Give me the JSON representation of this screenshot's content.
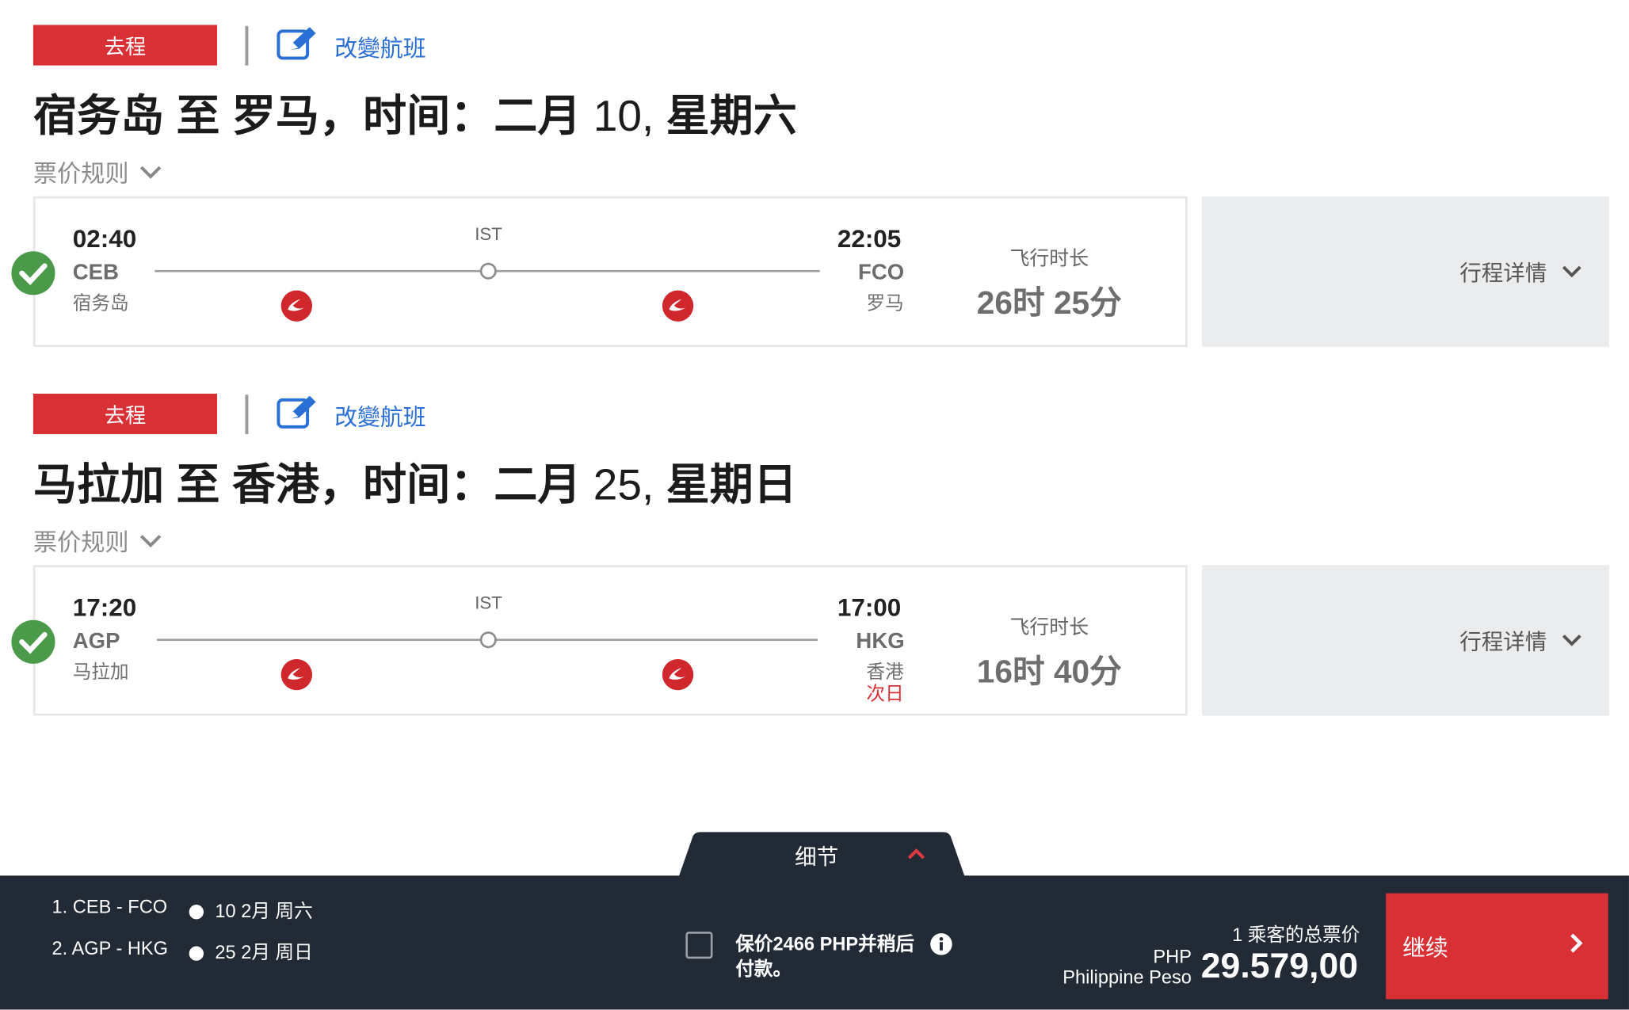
{
  "outbound": {
    "badge": "去程",
    "change_label": "改變航班",
    "title_a": "宿务岛 至 罗马，时间：二月 ",
    "title_day": "10,",
    "title_b": " 星期六",
    "fare_rules": "票价规则",
    "dep_time": "02:40",
    "dep_code": "CEB",
    "dep_city": "宿务岛",
    "via": "IST",
    "arr_time": "22:05",
    "arr_code": "FCO",
    "arr_city": "罗马",
    "duration_label": "飞行时长",
    "duration": "26时 25分",
    "details_label": "行程详情"
  },
  "return": {
    "badge": "去程",
    "change_label": "改變航班",
    "title_a": "马拉加 至 香港，时间：二月 ",
    "title_day": "25,",
    "title_b": " 星期日",
    "fare_rules": "票价规则",
    "dep_time": "17:20",
    "dep_code": "AGP",
    "dep_city": "马拉加",
    "via": "IST",
    "arr_time": "17:00",
    "arr_code": "HKG",
    "arr_city": "香港",
    "next_day": "次日",
    "duration_label": "飞行时长",
    "duration": "16时 40分",
    "details_label": "行程详情"
  },
  "summary": {
    "tab_label": "细节",
    "legs": [
      {
        "route": "1.  CEB - FCO",
        "date": "10 2月 周六"
      },
      {
        "route": "2.  AGP - HKG",
        "date": "25 2月 周日"
      }
    ],
    "hold_text_1": "保价2466 PHP并稍后",
    "hold_text_2": "付款。",
    "total_label": "1 乘客的总票价",
    "currency_code": "PHP",
    "currency_name": "Philippine Peso",
    "price": "29.579,00",
    "continue_label": "继续"
  },
  "colors": {
    "accent": "#d93036",
    "link": "#2a6fd6",
    "ok": "#4a9a4a",
    "footer": "#222a36"
  }
}
